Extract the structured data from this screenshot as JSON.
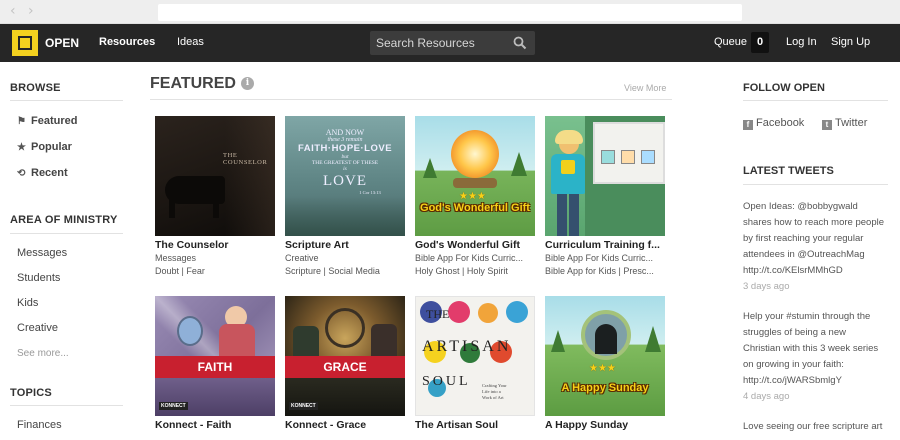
{
  "nav": {
    "logo": "OPEN",
    "resources": "Resources",
    "ideas": "Ideas",
    "search_placeholder": "Search Resources",
    "queue_label": "Queue",
    "queue_count": "0",
    "login": "Log In",
    "signup": "Sign Up"
  },
  "sidebar": {
    "browse": {
      "title": "BROWSE",
      "items": [
        "Featured",
        "Popular",
        "Recent"
      ]
    },
    "ministry": {
      "title": "AREA OF MINISTRY",
      "items": [
        "Messages",
        "Students",
        "Kids",
        "Creative"
      ],
      "see_more": "See more..."
    },
    "topics": {
      "title": "TOPICS",
      "items": [
        "Finances"
      ]
    }
  },
  "main": {
    "title": "FEATURED",
    "info": "i",
    "view_more": "View More",
    "cards": [
      {
        "title": "The Counselor",
        "line1": "Messages",
        "line2": "Doubt | Fear",
        "thumb_text": "THE COUNSELOR"
      },
      {
        "title": "Scripture Art",
        "line1": "Creative",
        "line2": "Scripture | Social Media",
        "thumb_lines": [
          "AND NOW",
          "these 3 remain",
          "FAITH·HOPE·LOVE",
          "but",
          "THE GREATEST OF THESE",
          "is",
          "LOVE",
          "1 Cor 13:13"
        ]
      },
      {
        "title": "God's Wonderful Gift",
        "line1": "Bible App For Kids Curric...",
        "line2": "Holy Ghost | Holy Spirit",
        "thumb_text": "God's Wonderful Gift"
      },
      {
        "title": "Curriculum Training f...",
        "line1": "Bible App For Kids Curric...",
        "line2": "Bible App for Kids | Presc..."
      },
      {
        "title": "Konnect - Faith",
        "thumb_text": "FAITH",
        "badge": "KONNECT"
      },
      {
        "title": "Konnect - Grace",
        "thumb_text": "GRACE",
        "badge": "KONNECT"
      },
      {
        "title": "The Artisan Soul",
        "thumb_lines": [
          "THE",
          "ARTISAN",
          "SOUL"
        ],
        "thumb_caption": [
          "Crafting Your",
          "Life into a",
          "Work of Art"
        ]
      },
      {
        "title": "A Happy Sunday",
        "thumb_text": "A Happy Sunday"
      }
    ]
  },
  "right": {
    "follow_title": "FOLLOW OPEN",
    "facebook": "Facebook",
    "facebook_glyph": "f",
    "twitter": "Twitter",
    "twitter_glyph": "t",
    "tweets_title": "LATEST TWEETS",
    "tweets": [
      {
        "lines": [
          "Open Ideas: @bobbygwald",
          "shares how to reach more people",
          "by first reaching your regular",
          "attendees in @OutreachMag",
          "http://t.co/KElsrMMhGD"
        ],
        "time": "3 days ago"
      },
      {
        "lines": [
          "Help your #stumin through the",
          "struggles of being a new",
          "Christian with this 3 week series",
          "on growing in your faith:",
          "http://t.co/jWARSbmlgY"
        ],
        "time": "4 days ago"
      },
      {
        "lines": [
          "Love seeing our free scripture art"
        ],
        "time": ""
      }
    ]
  },
  "colors": {
    "nav_bg": "#262626",
    "logo_yellow": "#f4d11f",
    "konnect_red": "#c8202f",
    "gold_text": "#f7d117"
  }
}
